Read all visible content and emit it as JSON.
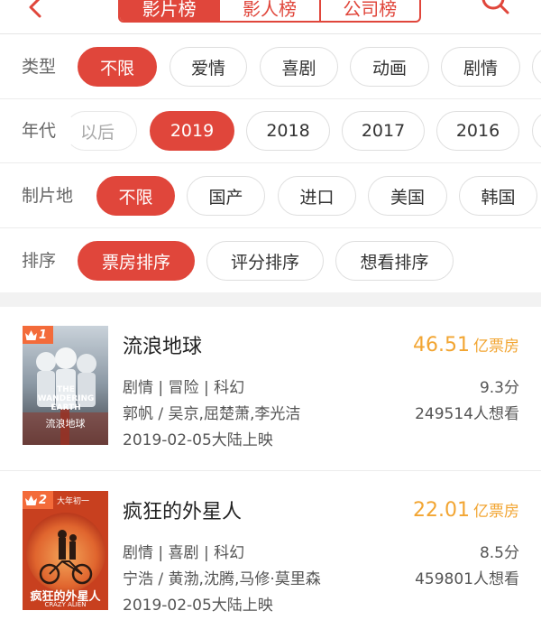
{
  "nav": {
    "tabs": [
      "影片榜",
      "影人榜",
      "公司榜"
    ],
    "active_tab": 0
  },
  "filters": {
    "type": {
      "label": "类型",
      "options": [
        "不限",
        "爱情",
        "喜剧",
        "动画",
        "剧情"
      ]
    },
    "year": {
      "label": "年代",
      "options": [
        "以后",
        "2019",
        "2018",
        "2017",
        "2016"
      ]
    },
    "region": {
      "label": "制片地",
      "options": [
        "不限",
        "国产",
        "进口",
        "美国",
        "韩国"
      ]
    },
    "sort": {
      "label": "排序",
      "options": [
        "票房排序",
        "评分排序",
        "想看排序"
      ]
    }
  },
  "movies": [
    {
      "rank": "1",
      "title": "流浪地球",
      "genres": "剧情 | 冒险 | 科幻",
      "cast": "郭帆 / 吴京,屈楚萧,李光洁",
      "release": "2019-02-05大陆上映",
      "box_value": "46.51",
      "box_unit": "亿票房",
      "score": "9.3分",
      "want": "249514人想看",
      "poster_text": "THE WANDERING EARTH",
      "poster_cn": "流浪地球"
    },
    {
      "rank": "2",
      "title": "疯狂的外星人",
      "genres": "剧情 | 喜剧 | 科幻",
      "cast": "宁浩 / 黄渤,沈腾,马修·莫里森",
      "release": "2019-02-05大陆上映",
      "box_value": "22.01",
      "box_unit": "亿票房",
      "score": "8.5分",
      "want": "459801人想看",
      "poster_text": "大年初一",
      "poster_cn": "疯狂的外星人",
      "poster_en": "CRAZY ALIEN"
    }
  ]
}
